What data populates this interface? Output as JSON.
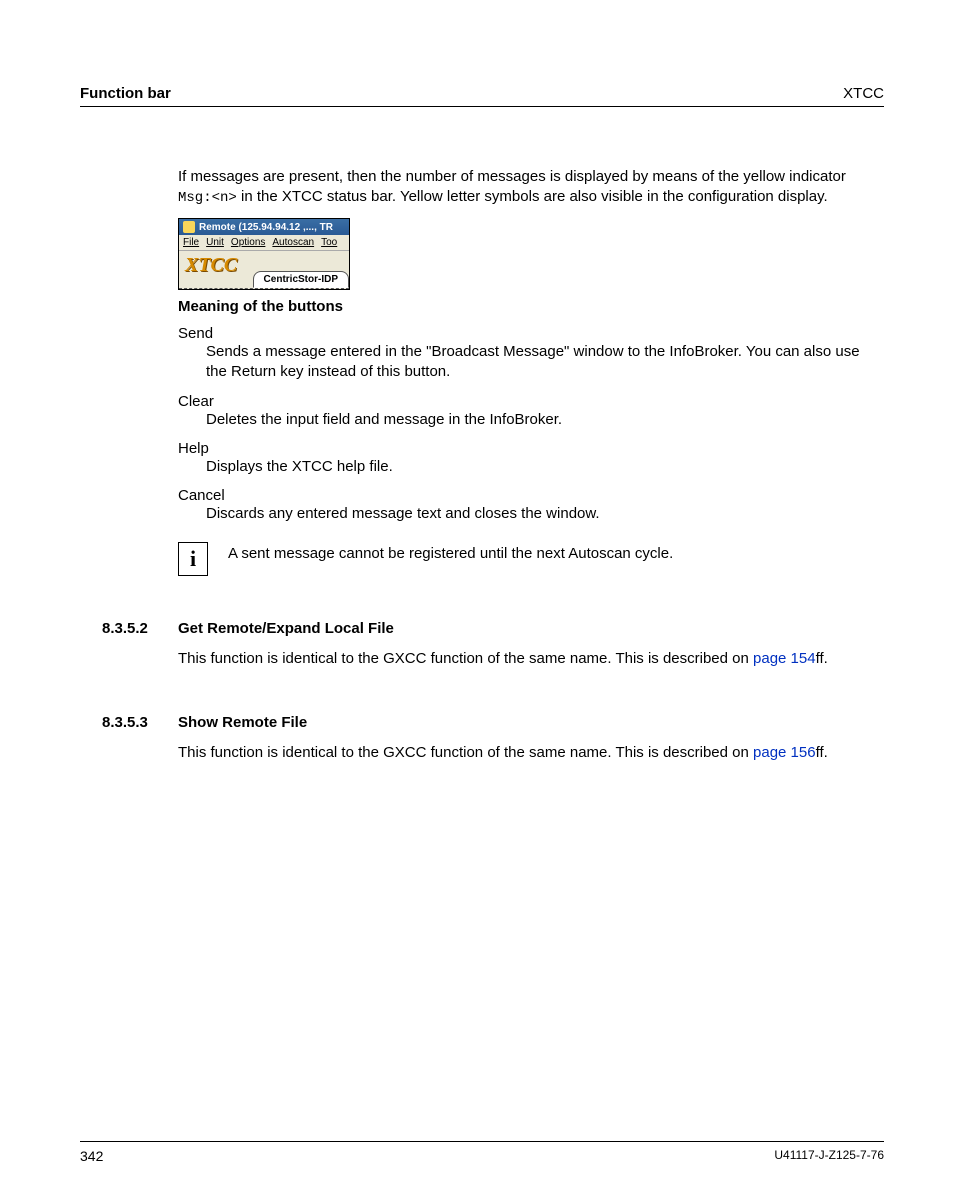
{
  "header": {
    "left": "Function bar",
    "right": "XTCC"
  },
  "intro": {
    "pre": "If messages are present, then the number of messages is displayed by means of the yellow indicator ",
    "code": "Msg:<n>",
    "post": " in the XTCC status bar. Yellow letter symbols are also visible in the configuration display."
  },
  "screenshot": {
    "title": "Remote (125.94.94.12 ,..., TR",
    "menu": {
      "file": "File",
      "unit": "Unit",
      "options": "Options",
      "autoscan": "Autoscan",
      "too": "Too"
    },
    "logo": "XTCC",
    "tab": "CentricStor-IDP"
  },
  "meaning_heading": "Meaning of the buttons",
  "buttons": {
    "send": {
      "term": "Send",
      "def": "Sends a message entered in the \"Broadcast Message\" window to the InfoBroker. You can also use the Return key instead of this button."
    },
    "clear": {
      "term": "Clear",
      "def": "Deletes the input field and message in the InfoBroker."
    },
    "help": {
      "term": "Help",
      "def": "Displays the XTCC help file."
    },
    "cancel": {
      "term": "Cancel",
      "def": "Discards any entered message text and closes the window."
    }
  },
  "note": {
    "glyph": "i",
    "text": "A sent message cannot be registered until the next Autoscan cycle."
  },
  "sec1": {
    "num": "8.3.5.2",
    "title": "Get Remote/Expand Local File",
    "body_pre": "This function is identical to the GXCC function of the same name. This is described on ",
    "link": "page 154",
    "body_post": "ff."
  },
  "sec2": {
    "num": "8.3.5.3",
    "title": "Show Remote File",
    "body_pre": "This function is identical to the GXCC function of the same name. This is described on ",
    "link": "page 156",
    "body_post": "ff."
  },
  "footer": {
    "page": "342",
    "docid": "U41117-J-Z125-7-76"
  }
}
